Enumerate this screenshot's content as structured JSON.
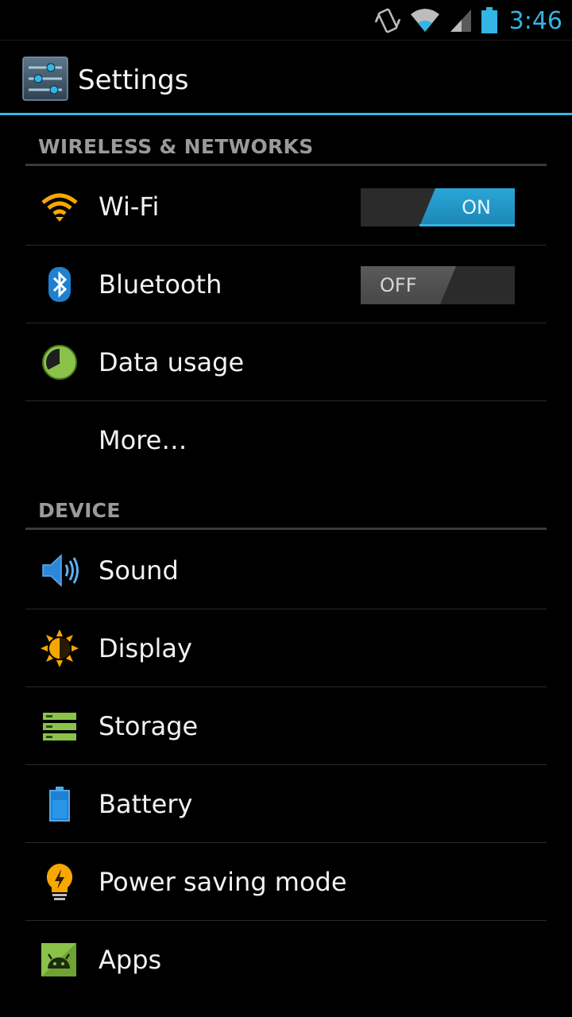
{
  "status_bar": {
    "time": "3:46",
    "icons": [
      "vibrate-icon",
      "wifi-signal-icon",
      "cell-signal-icon",
      "battery-icon"
    ]
  },
  "action_bar": {
    "title": "Settings",
    "icon": "settings-sliders-icon"
  },
  "sections": {
    "wireless": {
      "header": "WIRELESS & NETWORKS",
      "items": {
        "wifi": {
          "label": "Wi-Fi",
          "icon": "wifi-icon",
          "toggle": "ON"
        },
        "bluetooth": {
          "label": "Bluetooth",
          "icon": "bluetooth-icon",
          "toggle": "OFF"
        },
        "data_usage": {
          "label": "Data usage",
          "icon": "data-usage-icon"
        },
        "more": {
          "label": "More…"
        }
      }
    },
    "device": {
      "header": "DEVICE",
      "items": {
        "sound": {
          "label": "Sound",
          "icon": "speaker-icon"
        },
        "display": {
          "label": "Display",
          "icon": "brightness-icon"
        },
        "storage": {
          "label": "Storage",
          "icon": "storage-icon"
        },
        "battery": {
          "label": "Battery",
          "icon": "battery-icon"
        },
        "power_saving": {
          "label": "Power saving mode",
          "icon": "lightbulb-icon"
        },
        "apps": {
          "label": "Apps",
          "icon": "android-apps-icon"
        }
      }
    }
  },
  "colors": {
    "accent": "#33b5e5",
    "background": "#000000",
    "divider": "#2a2a2a",
    "section_header": "#9a9a9a"
  }
}
